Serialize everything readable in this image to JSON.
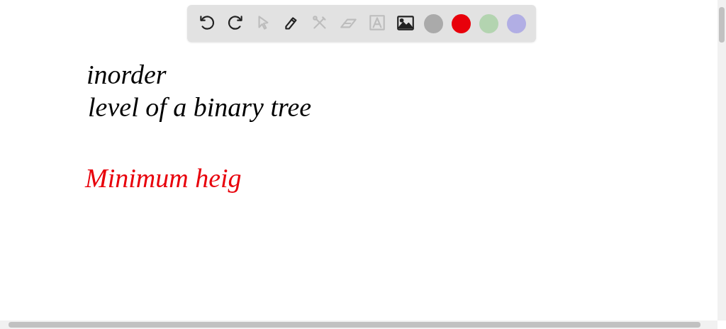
{
  "toolbar": {
    "tools": [
      {
        "kind": "undo",
        "disabled": false
      },
      {
        "kind": "redo",
        "disabled": false
      },
      {
        "kind": "pointer",
        "disabled": true
      },
      {
        "kind": "pen",
        "disabled": false
      },
      {
        "kind": "tools",
        "disabled": true
      },
      {
        "kind": "eraser",
        "disabled": true
      },
      {
        "kind": "text",
        "disabled": true
      },
      {
        "kind": "image",
        "disabled": false
      }
    ],
    "colors": [
      {
        "color": "#aaaaaa"
      },
      {
        "color": "#e8000b"
      },
      {
        "color": "#b3d4b0"
      },
      {
        "color": "#b1aee4"
      }
    ]
  },
  "canvas": {
    "notes": [
      {
        "text": "inorder",
        "color": "#000000"
      },
      {
        "text": "level of a binary tree",
        "color": "#000000"
      },
      {
        "text": "Minimum heig",
        "color": "#e8000b"
      }
    ]
  }
}
